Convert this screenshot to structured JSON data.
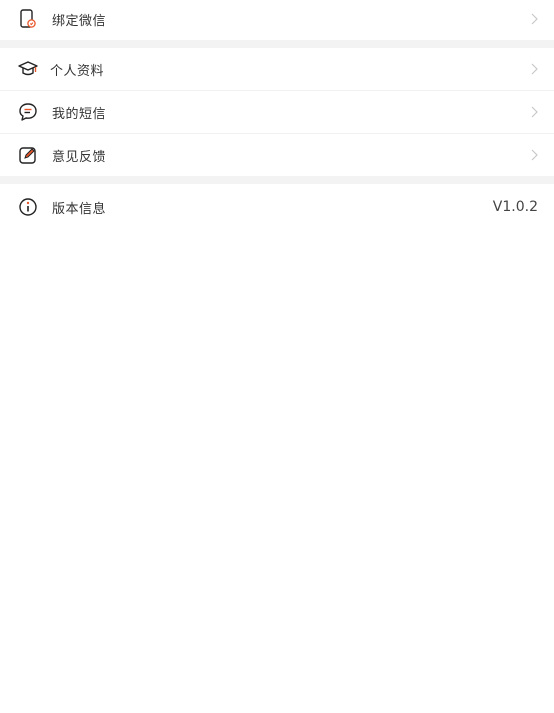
{
  "section1": {
    "items": [
      {
        "label": "绑定微信",
        "icon": "phone-bind-icon"
      }
    ]
  },
  "section2": {
    "items": [
      {
        "label": "个人资料",
        "icon": "graduation-cap-icon"
      },
      {
        "label": "我的短信",
        "icon": "chat-bubble-icon"
      },
      {
        "label": "意见反馈",
        "icon": "edit-icon"
      }
    ]
  },
  "section3": {
    "version_label": "版本信息",
    "version_value": "V1.0.2",
    "icon": "info-icon"
  },
  "colors": {
    "icon": "#222222",
    "accent": "#e8572b",
    "chevron": "#c8c8c8",
    "separator": "#f3f3f3"
  }
}
